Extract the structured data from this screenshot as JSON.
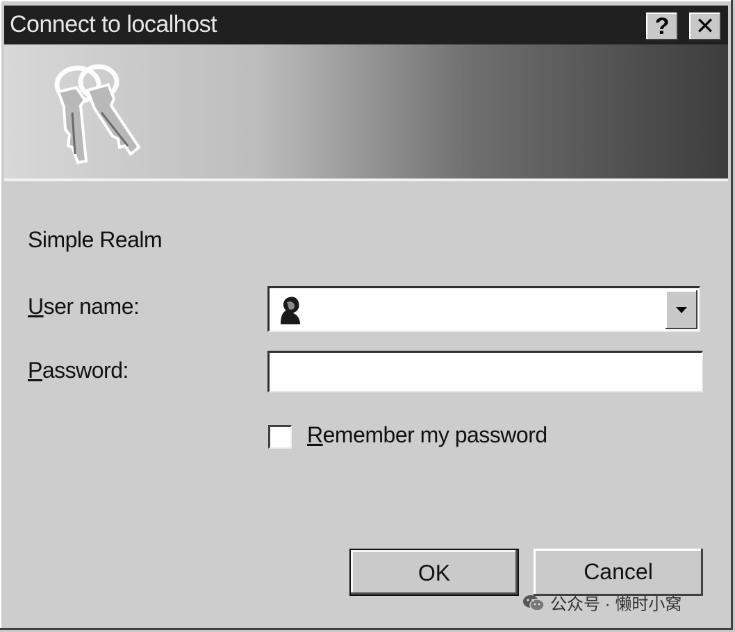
{
  "window": {
    "title": "Connect to localhost",
    "help_button": "?",
    "close_button": "✕"
  },
  "body": {
    "realm": "Simple Realm",
    "user_label_mnemonic": "U",
    "user_label_rest": "ser name:",
    "password_label_mnemonic": "P",
    "password_label_rest": "assword:",
    "user_value": "",
    "password_value": "",
    "remember_mnemonic": "R",
    "remember_rest": "emember my password",
    "remember_checked": false
  },
  "buttons": {
    "ok": "OK",
    "cancel": "Cancel"
  },
  "watermark": {
    "text": "公众号 · 懒时小窝"
  },
  "icons": {
    "banner": "keys-icon",
    "user": "user-icon",
    "dropdown": "chevron-down-icon",
    "watermark": "wechat-logo"
  }
}
